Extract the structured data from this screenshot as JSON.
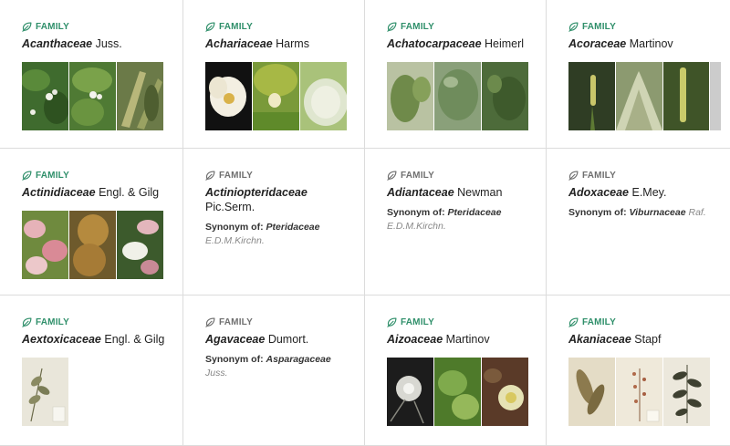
{
  "family_label": "FAMILY",
  "synonym_label": "Synonym of:",
  "colors": {
    "accepted_accent": "#2f8f6a",
    "synonym_gray": "#6f6f6f",
    "border": "#dcdcdc"
  },
  "families": [
    {
      "name": "Acanthaceae",
      "author": "Juss.",
      "icon": "leaf-icon",
      "photos": 3
    },
    {
      "name": "Achariaceae",
      "author": "Harms",
      "icon": "leaf-icon",
      "photos": 3
    },
    {
      "name": "Achatocarpaceae",
      "author": "Heimerl",
      "icon": "leaf-icon",
      "photos": 3
    },
    {
      "name": "Acoraceae",
      "author": "Martinov",
      "icon": "leaf-icon",
      "photos": 3
    },
    {
      "name": "Actinidiaceae",
      "author": "Engl. & Gilg",
      "icon": "leaf-icon",
      "photos": 3
    },
    {
      "name": "Actiniopteridaceae",
      "author": "Pic.Serm.",
      "icon": "leaf-icon",
      "synonym_of": "Pteridaceae",
      "synonym_author": "E.D.M.Kirchn."
    },
    {
      "name": "Adiantaceae",
      "author": "Newman",
      "icon": "leaf-icon",
      "synonym_of": "Pteridaceae",
      "synonym_author": "E.D.M.Kirchn."
    },
    {
      "name": "Adoxaceae",
      "author": "E.Mey.",
      "icon": "leaf-icon",
      "synonym_of": "Viburnaceae",
      "synonym_author": "Raf."
    },
    {
      "name": "Aextoxicaceae",
      "author": "Engl. & Gilg",
      "icon": "leaf-icon",
      "photos": 1
    },
    {
      "name": "Agavaceae",
      "author": "Dumort.",
      "icon": "leaf-icon",
      "synonym_of": "Asparagaceae",
      "synonym_author": "Juss."
    },
    {
      "name": "Aizoaceae",
      "author": "Martinov",
      "icon": "leaf-icon",
      "photos": 3
    },
    {
      "name": "Akaniaceae",
      "author": "Stapf",
      "icon": "leaf-icon",
      "photos": 3
    }
  ]
}
